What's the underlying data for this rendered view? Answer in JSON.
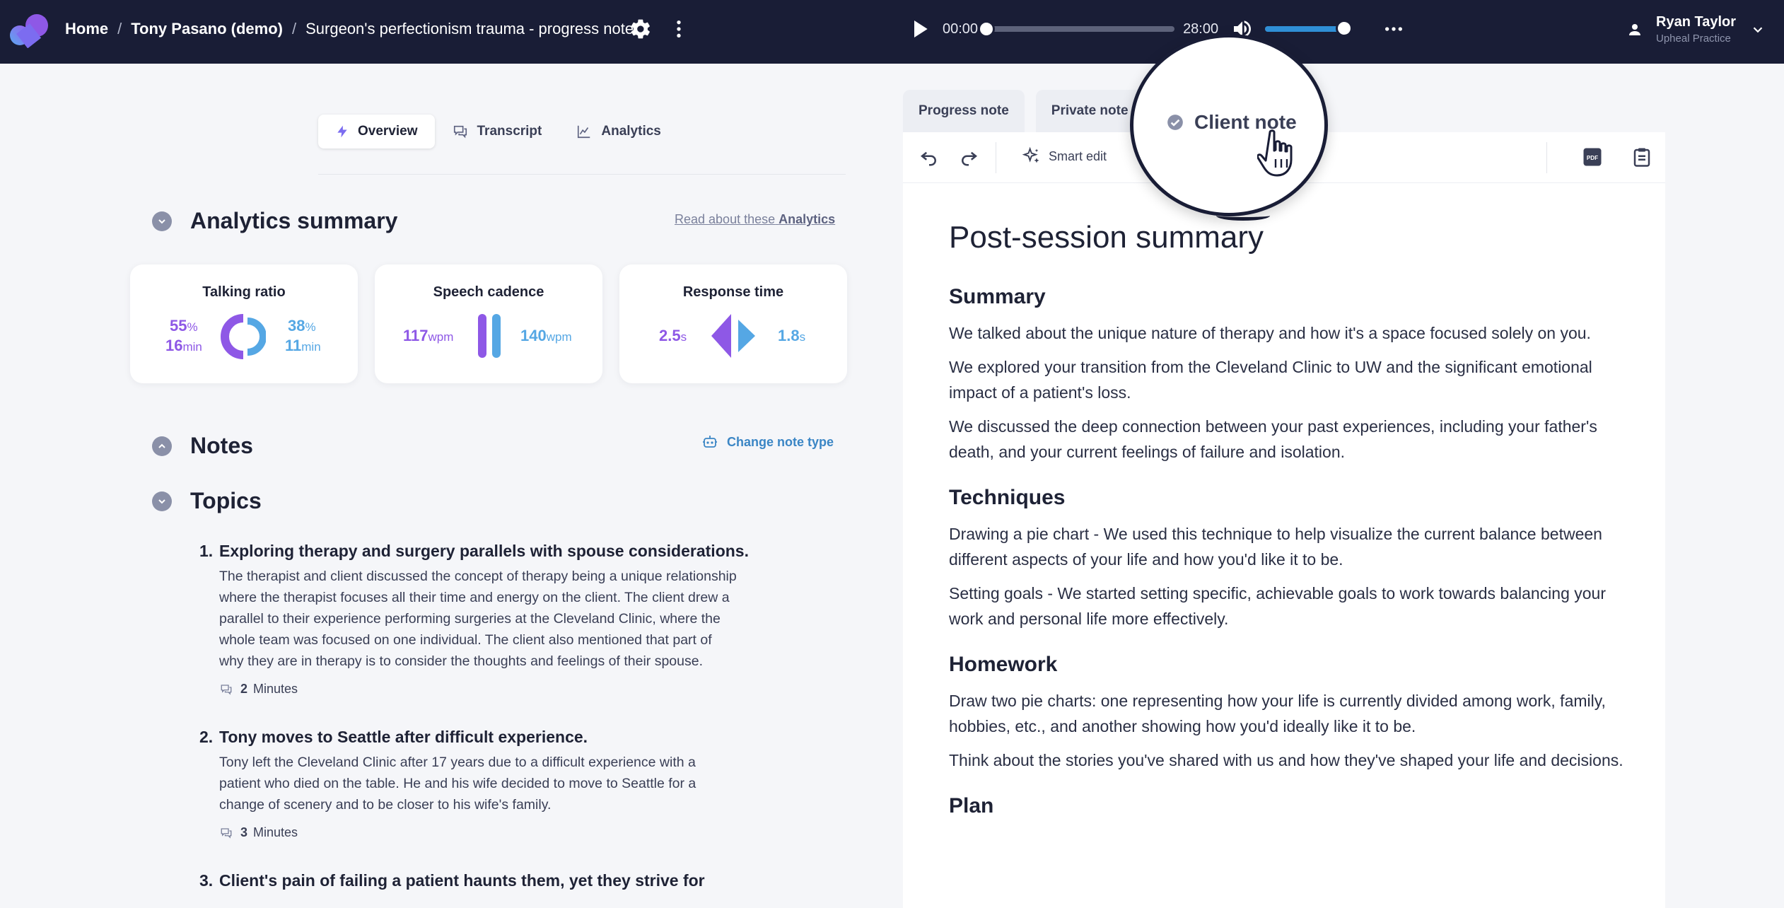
{
  "header": {
    "breadcrumb": [
      "Home",
      "Tony Pasano (demo)",
      "Surgeon's perfectionism trauma - progress note"
    ],
    "icons": [
      "settings-icon",
      "more-vertical-icon"
    ]
  },
  "player": {
    "current_time": "00:00",
    "duration": "28:00",
    "progress": 0,
    "volume": 0.9
  },
  "user": {
    "name": "Ryan Taylor",
    "practice": "Upheal Practice"
  },
  "left_tabs": [
    {
      "label": "Overview",
      "icon": "bolt-icon",
      "active": true
    },
    {
      "label": "Transcript",
      "icon": "chat-icon",
      "active": false
    },
    {
      "label": "Analytics",
      "icon": "chart-icon",
      "active": false
    }
  ],
  "analytics": {
    "title": "Analytics summary",
    "link_prefix": "Read about these",
    "link_bold": "Analytics",
    "cards": {
      "talking": {
        "title": "Talking ratio",
        "left_pct": "55",
        "left_pct_unit": "%",
        "left_min": "16",
        "left_min_unit": "min",
        "right_pct": "38",
        "right_pct_unit": "%",
        "right_min": "11",
        "right_min_unit": "min"
      },
      "cadence": {
        "title": "Speech cadence",
        "left_value": "117",
        "left_unit": "wpm",
        "right_value": "140",
        "right_unit": "wpm"
      },
      "response": {
        "title": "Response time",
        "left_value": "2.5",
        "left_unit": "s",
        "right_value": "1.8",
        "right_unit": "s"
      }
    }
  },
  "notes": {
    "title": "Notes",
    "change_type": "Change note type"
  },
  "topics": {
    "title": "Topics",
    "items": [
      {
        "number": "1.",
        "title": "Exploring therapy and surgery parallels with spouse considerations.",
        "lines": [
          "The therapist and client discussed the concept of therapy being a unique relationship",
          "where the therapist focuses all their time and energy on the client. The client drew a",
          "parallel to their experience performing surgeries at the Cleveland Clinic, where the",
          "whole team was focused on one individual. The client also mentioned that part of",
          "why they are in therapy is to consider the thoughts and feelings of their spouse."
        ],
        "minutes": "2",
        "minutes_label": "Minutes"
      },
      {
        "number": "2.",
        "title": "Tony moves to Seattle after difficult experience.",
        "lines": [
          "Tony left the Cleveland Clinic after 17 years due to a difficult experience with a",
          "patient who died on the table. He and his wife decided to move to Seattle for a",
          "change of scenery and to be closer to his wife's family."
        ],
        "minutes": "3",
        "minutes_label": "Minutes"
      },
      {
        "number": "3.",
        "title": "Client's pain of failing a patient haunts them, yet they strive for"
      }
    ]
  },
  "right_tabs": [
    "Progress note",
    "Private note"
  ],
  "magnifier_tab": "Client note",
  "editor": {
    "smart_edit": "Smart edit",
    "icons": [
      "undo-icon",
      "redo-icon",
      "sparkle-icon",
      "pdf-icon",
      "clipboard-icon"
    ]
  },
  "document": {
    "title": "Post-session summary",
    "summary_heading": "Summary",
    "summary": [
      "We talked about the unique nature of therapy and how it's a space focused solely on you.",
      "We explored your transition from the Cleveland Clinic to UW and the significant emotional impact of a patient's loss.",
      "We discussed the deep connection between your past experiences, including your father's death, and your current feelings of failure and isolation."
    ],
    "techniques_heading": "Techniques",
    "techniques": [
      "Drawing a pie chart - We used this technique to help visualize the current balance between different aspects of your life and how you'd like it to be.",
      "Setting goals - We started setting specific, achievable goals to work towards balancing your work and personal life more effectively."
    ],
    "homework_heading": "Homework",
    "homework": [
      "Draw two pie charts: one representing how your life is currently divided among work, family, hobbies, etc., and another showing how you'd ideally like it to be.",
      "Think about the stories you've shared with us and how they've shaped your life and decisions."
    ],
    "plan_heading": "Plan"
  },
  "colors": {
    "topbar": "#191d36",
    "accent_purple": "#8e58e6",
    "accent_blue": "#55a7e4",
    "link_blue": "#3b86c5"
  }
}
